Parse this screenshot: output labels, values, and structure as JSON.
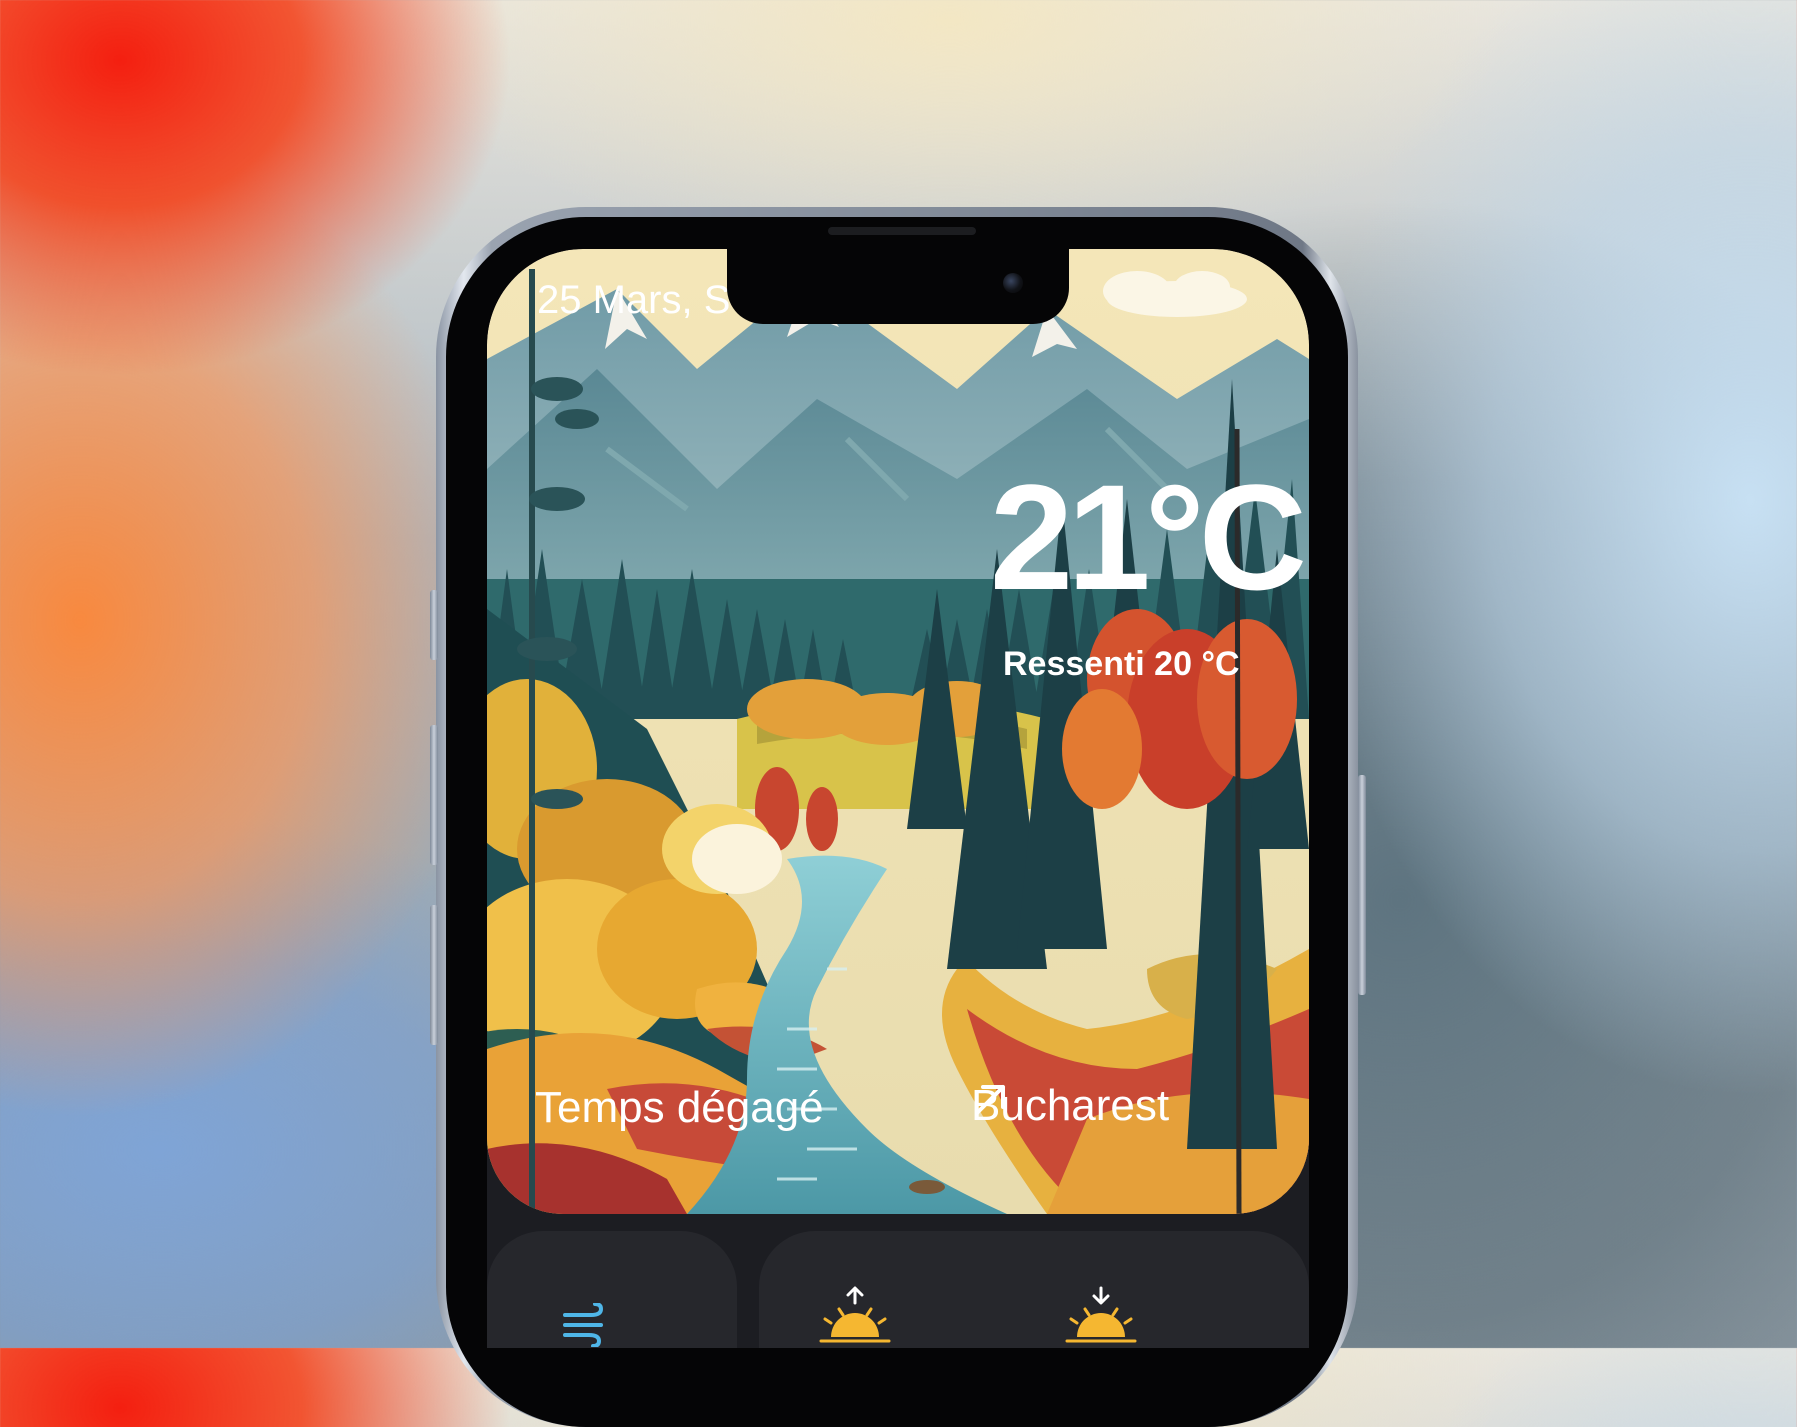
{
  "weather": {
    "date": "25 Mars, S",
    "temperature": "21°C",
    "feels_like": "Ressenti 20 °C",
    "condition": "Temps dégagé",
    "city": "Bucharest"
  },
  "cards": {
    "wind_icon": "wind-icon",
    "sunrise_icon": "sunrise-icon",
    "sunset_icon": "sunset-icon"
  },
  "colors": {
    "card_background": "#26272c",
    "screen_background": "#1c1d22",
    "sun_yellow": "#f5b731",
    "wind_blue": "#4fb6e8"
  }
}
